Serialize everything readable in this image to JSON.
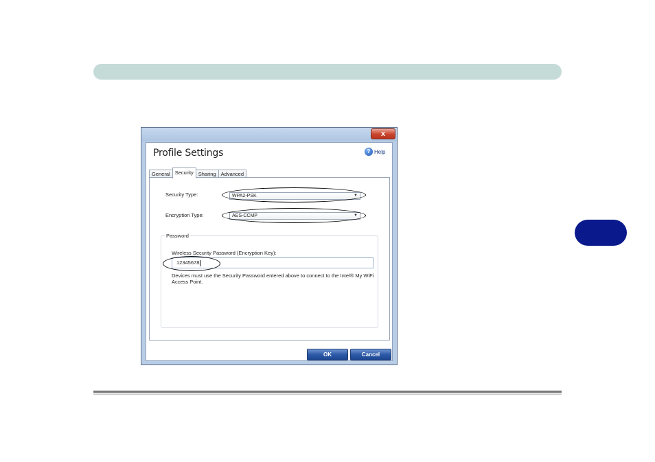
{
  "dialog": {
    "title": "Profile Settings",
    "close_label": "x",
    "help_label": "Help",
    "help_icon": "?"
  },
  "tabs": [
    {
      "label": "General",
      "active": false
    },
    {
      "label": "Security",
      "active": true
    },
    {
      "label": "Sharing",
      "active": false
    },
    {
      "label": "Advanced",
      "active": false
    }
  ],
  "security": {
    "security_type_label": "Security Type:",
    "security_type_value": "WPA2-PSK",
    "encryption_type_label": "Encryption Type:",
    "encryption_type_value": "AES-CCMP",
    "dropdown_arrow": "▼"
  },
  "password": {
    "group_title": "Password",
    "field_label": "Wireless Security Password (Encryption Key):",
    "field_value": "12345678",
    "note": "Devices must use the Security Password entered above to connect to the Intel® My WiFi Access Point."
  },
  "buttons": {
    "ok_label": "OK",
    "cancel_label": "Cancel"
  },
  "colors": {
    "header_bar": "#c5dbd8",
    "side_tab": "#0a1a8c",
    "button_blue": "#2d5aa8",
    "close_red": "#c9442c"
  }
}
